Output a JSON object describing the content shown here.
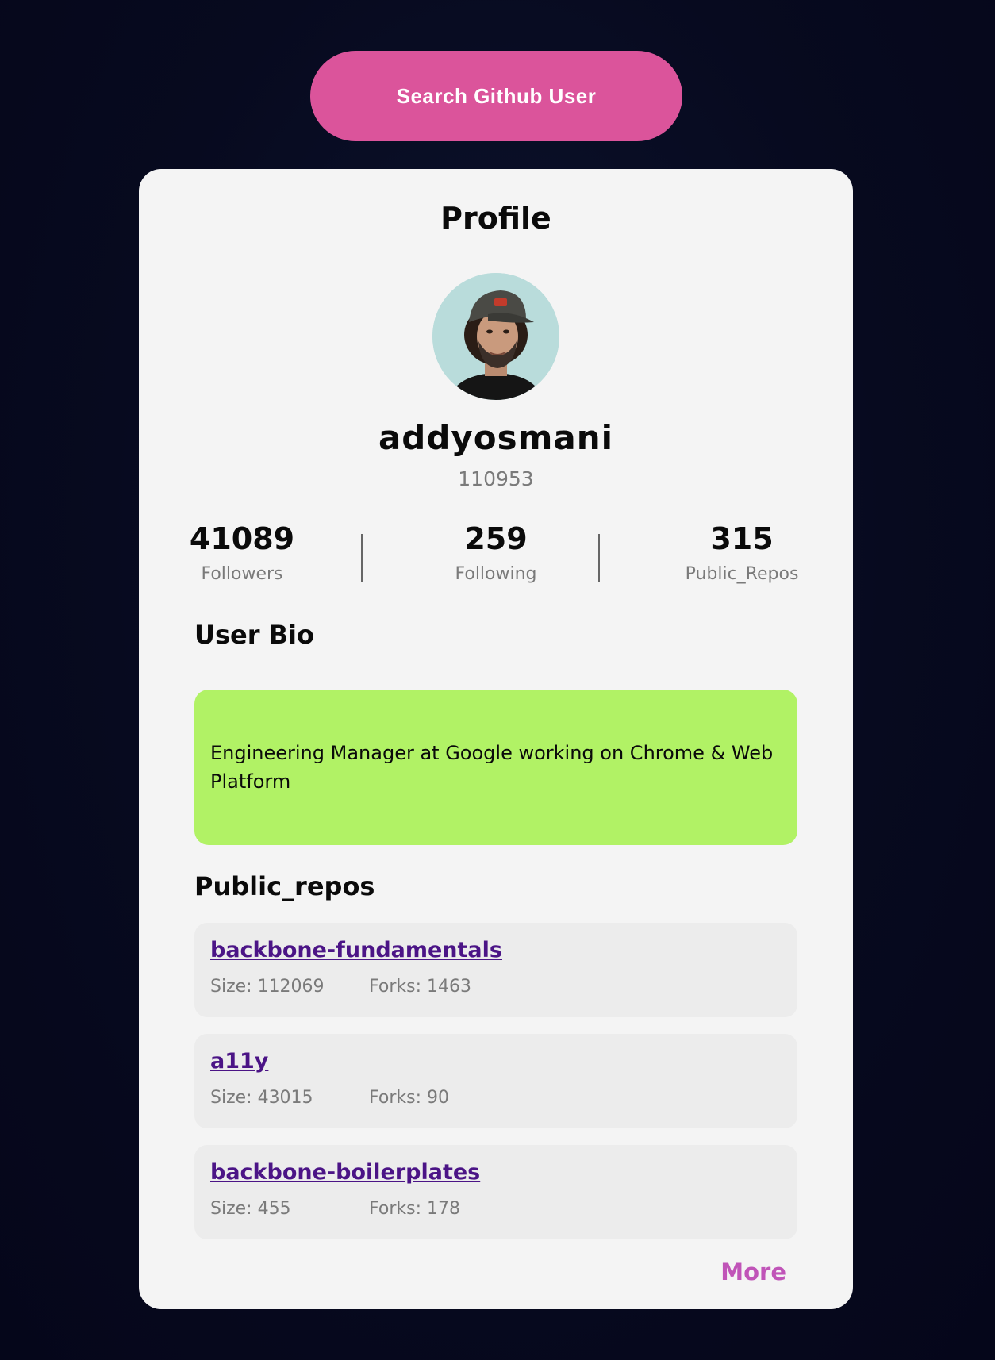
{
  "search_button": {
    "label": "Search Github User"
  },
  "profile": {
    "title": "Profile",
    "avatar_icon": "user-avatar-photo",
    "username": "addyosmani",
    "user_id": "110953",
    "stats": [
      {
        "value": "41089",
        "label": "Followers"
      },
      {
        "value": "259",
        "label": "Following"
      },
      {
        "value": "315",
        "label": "Public_Repos"
      }
    ]
  },
  "bio": {
    "heading": "User Bio",
    "text": "Engineering Manager at Google working on Chrome & Web Platform"
  },
  "repos": {
    "heading": "Public_repos",
    "items": [
      {
        "name": "backbone-fundamentals",
        "size": "Size: 112069",
        "forks": "Forks: 1463"
      },
      {
        "name": "a11y",
        "size": "Size: 43015",
        "forks": "Forks: 90"
      },
      {
        "name": "backbone-boilerplates",
        "size": "Size: 455",
        "forks": "Forks: 178"
      }
    ],
    "more_label": "More"
  },
  "colors": {
    "accent_pink": "#db549b",
    "bio_green": "#b1f265",
    "repo_link": "#4b1486",
    "more_link": "#c054b8"
  }
}
